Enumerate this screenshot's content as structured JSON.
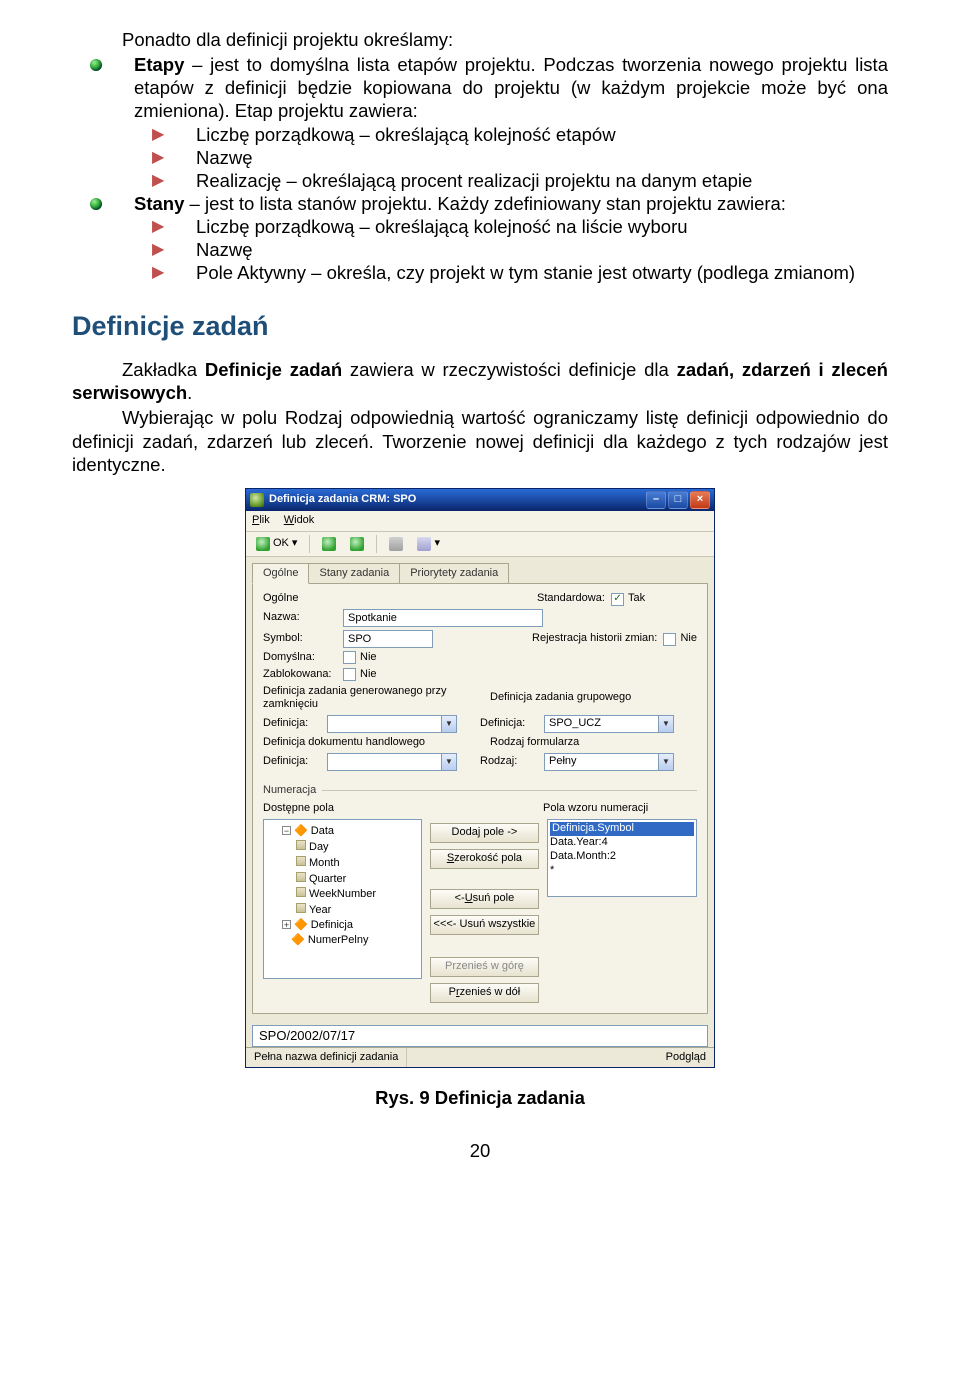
{
  "doc": {
    "p1": "Ponadto dla definicji projektu określamy:",
    "b1_bold": "Etapy",
    "b1_rest": " – jest to domyślna lista etapów projektu. Podczas tworzenia nowego projektu lista etapów z definicji będzie kopiowana do projektu (w każdym projekcie może być ona zmieniona). Etap projektu zawiera:",
    "s1a": "Liczbę porządkową – określającą kolejność etapów",
    "s1b": "Nazwę",
    "s1c": "Realizację – określającą procent realizacji projektu na danym etapie",
    "b2_bold": "Stany",
    "b2_rest": " – jest to lista stanów projektu. Każdy zdefiniowany stan projektu zawiera:",
    "s2a": "Liczbę porządkową – określającą kolejność na liście wyboru",
    "s2b": "Nazwę",
    "s2c": "Pole Aktywny – określa, czy projekt w tym stanie jest otwarty (podlega zmianom)",
    "h2": "Definicje zadań",
    "p2a": "Zakładka ",
    "p2b_bold": "Definicje zadań",
    "p2c": " zawiera w rzeczywistości definicje dla ",
    "p2d_bold": "zadań, zdarzeń i zleceń serwisowych",
    "p2e": ".",
    "p3": "Wybierając w polu Rodzaj odpowiednią wartość ograniczamy listę definicji odpowiednio do definicji zadań, zdarzeń lub zleceń. Tworzenie nowej definicji dla każdego z tych rodzajów jest identyczne.",
    "caption": "Rys. 9 Definicja zadania",
    "pagenum": "20"
  },
  "win": {
    "title": "Definicja zadania CRM: SPO",
    "menu_plik": "Plik",
    "menu_widok": "Widok",
    "ok": "OK",
    "tab1": "Ogólne",
    "tab2": "Stany zadania",
    "tab3": "Priorytety zadania",
    "grp_ogolne": "Ogólne",
    "lbl_nazwa": "Nazwa:",
    "val_nazwa": "Spotkanie",
    "lbl_symbol": "Symbol:",
    "val_symbol": "SPO",
    "lbl_domyslna": "Domyślna:",
    "lbl_zablokowana": "Zablokowana:",
    "lbl_nie": "Nie",
    "lbl_standardowa": "Standardowa:",
    "lbl_tak": "Tak",
    "lbl_rejestr": "Rejestracja historii zmian:",
    "grp_left1": "Definicja zadania generowanego przy zamknięciu",
    "grp_right1": "Definicja zadania grupowego",
    "lbl_definicja": "Definicja:",
    "val_spoucz": "SPO_UCZ",
    "grp_left2": "Definicja dokumentu handlowego",
    "grp_right2": "Rodzaj formularza",
    "lbl_rodzaj": "Rodzaj:",
    "val_pelny": "Pełny",
    "grp_numer": "Numeracja",
    "lbl_dostepne": "Dostępne pola",
    "lbl_wzor": "Pola wzoru numeracji",
    "tree_data": "Data",
    "tree_day": "Day",
    "tree_month": "Month",
    "tree_quarter": "Quarter",
    "tree_week": "WeekNumber",
    "tree_year": "Year",
    "tree_def": "Definicja",
    "tree_numer": "NumerPelny",
    "btn_dodaj": "Dodaj pole ->",
    "btn_szer": "Szerokość pola",
    "btn_usun": "<- Usuń pole",
    "btn_usunw": "<<<- Usuń wszystkie",
    "btn_up": "Przenieś w górę",
    "btn_down": "Przenieś w dół",
    "patt1": "Definicja.Symbol",
    "patt2": "Data.Year:4",
    "patt3": "Data.Month:2",
    "patt4": "*",
    "preview": "SPO/2002/07/17",
    "status_left": "Pełna nazwa definicji zadania",
    "status_right": "Podgląd"
  }
}
